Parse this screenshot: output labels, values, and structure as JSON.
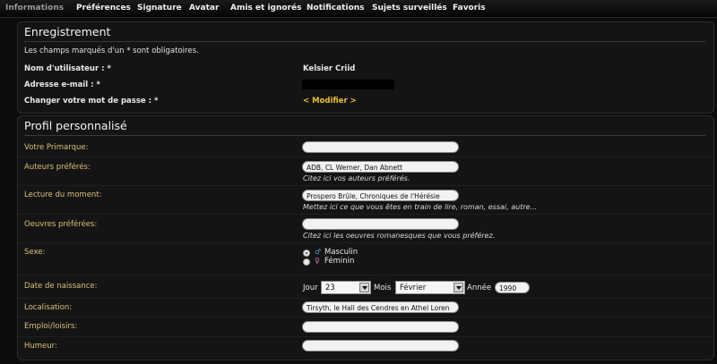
{
  "tabs": [
    {
      "label": "Informations"
    },
    {
      "label": "Préférences"
    },
    {
      "label": "Signature"
    },
    {
      "label": "Avatar"
    },
    {
      "label": "Amis et ignorés"
    },
    {
      "label": "Notifications"
    },
    {
      "label": "Sujets surveillés"
    },
    {
      "label": "Favoris"
    }
  ],
  "registration": {
    "title": "Enregistrement",
    "notice": "Les champs marqués d'un * sont obligatoires.",
    "username_label": "Nom d'utilisateur : *",
    "username_value": "Kelsier Criid",
    "email_label": "Adresse e-mail : *",
    "password_label": "Changer votre mot de passe : *",
    "modify_link": "< Modifier >"
  },
  "profile": {
    "title": "Profil personnalisé",
    "primarch_label": "Votre Primarque:",
    "primarch_value": "",
    "authors_label": "Auteurs préférés:",
    "authors_value": "ADB, CL Werner, Dan Abnett",
    "authors_help": "Citez ici vos auteurs préférés.",
    "reading_label": "Lecture du moment:",
    "reading_value": "Prospero Brûle, Chroniques de l'Hérésie",
    "reading_help": "Mettez ici ce que vous êtes en train de lire, roman, essai, autre...",
    "works_label": "Oeuvres préférées:",
    "works_value": "",
    "works_help": "Citez ici les oeuvres romanesques que vous préférez.",
    "sex_label": "Sexe:",
    "sex_options": [
      "Masculin",
      "Féminin"
    ],
    "sex_selected": "Masculin",
    "birth_label": "Date de naissance:",
    "day_label": "Jour",
    "day_value": "23",
    "month_label": "Mois",
    "month_value": "Février",
    "year_label": "Année",
    "year_value": "1990",
    "location_label": "Localisation:",
    "location_value": "Tirsyth, le Hall des Cendres en Athel Loren",
    "job_label": "Emploi/loisirs:",
    "job_value": "",
    "mood_label": "Humeur:",
    "mood_value": ""
  },
  "colors": {
    "label": "#d9c178",
    "link": "#e8c030",
    "background": "#0c0c0c"
  },
  "icons": {
    "male": "male-symbol-icon",
    "female": "female-symbol-icon",
    "dropdown": "chevron-down-icon"
  }
}
